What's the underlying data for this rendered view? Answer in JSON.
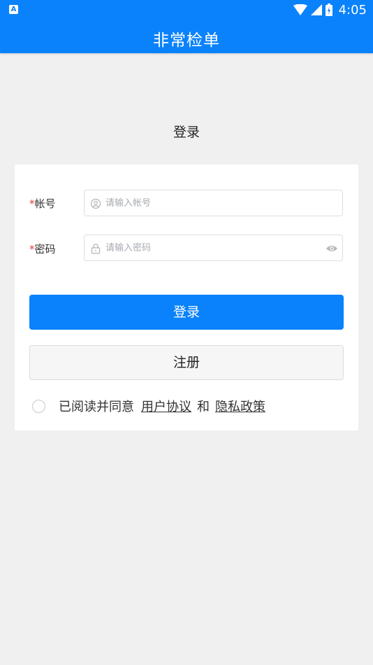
{
  "status_bar": {
    "left_icon": "A",
    "time": "4:05",
    "icons": [
      "wifi-icon",
      "signal-icon",
      "battery-icon"
    ]
  },
  "app_bar": {
    "title": "非常检单",
    "color": "#0a82fb"
  },
  "page": {
    "heading": "登录"
  },
  "form": {
    "account": {
      "required_mark": "*",
      "label": "帐号",
      "placeholder": "请输入帐号",
      "value": "",
      "icon": "user-circle-icon"
    },
    "password": {
      "required_mark": "*",
      "label": "密码",
      "placeholder": "请输入密码",
      "value": "",
      "icon": "lock-icon",
      "toggle_icon": "eye-icon"
    },
    "login_button": "登录",
    "register_button": "注册"
  },
  "agreement": {
    "checked": false,
    "prefix": "已阅读并同意",
    "user_agreement": "用户协议",
    "joiner": "和",
    "privacy_policy": "隐私政策"
  }
}
